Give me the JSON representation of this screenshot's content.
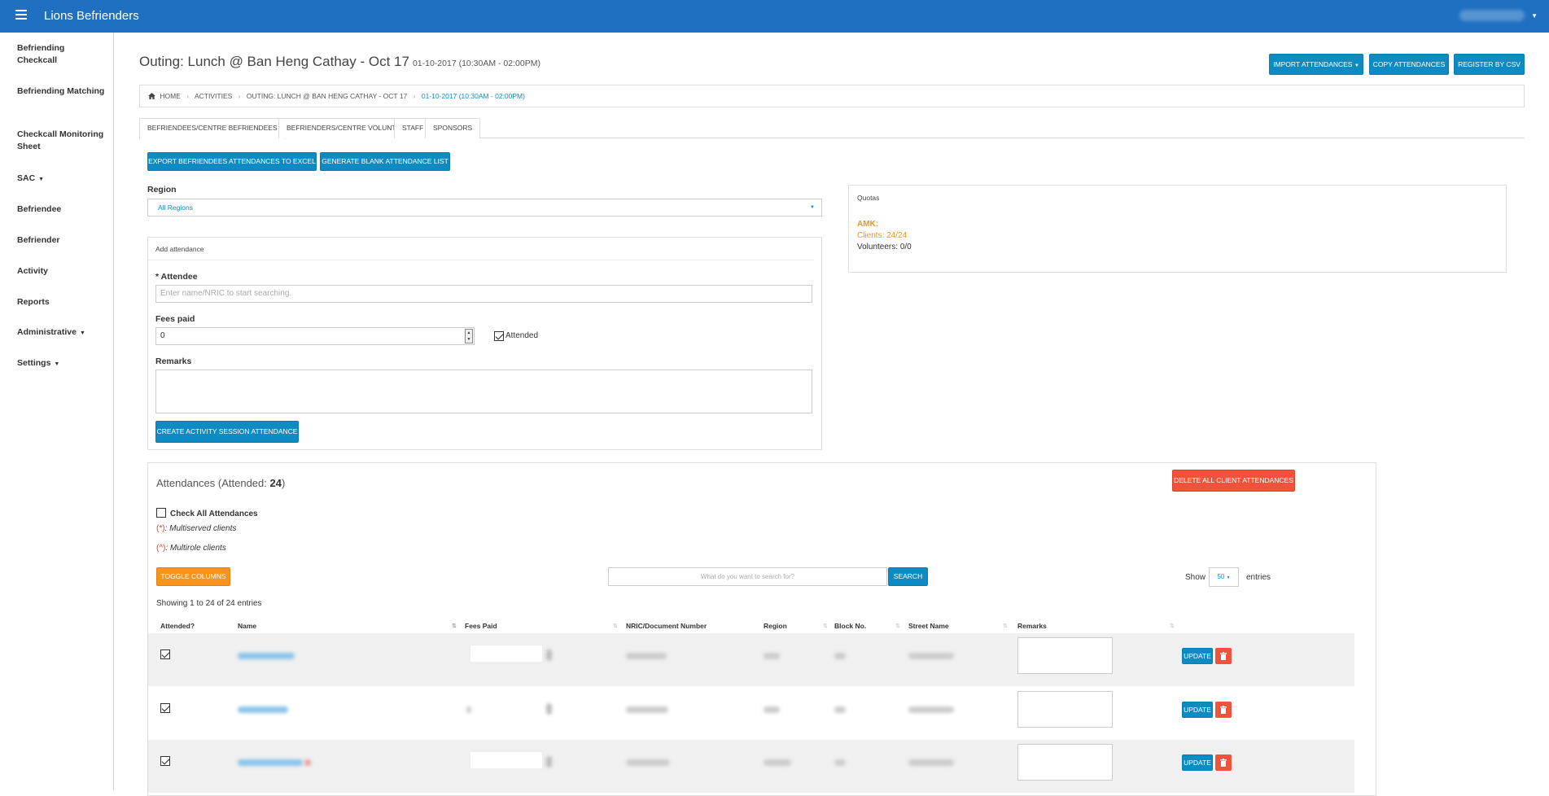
{
  "header": {
    "app_title": "Lions Befrienders"
  },
  "sidebar": {
    "items": [
      {
        "label": "Befriending Checkcall"
      },
      {
        "label": "Befriending Matching"
      },
      {
        "label": "Checkcall Monitoring Sheet"
      },
      {
        "label": "SAC"
      },
      {
        "label": "Befriendee"
      },
      {
        "label": "Befriender"
      },
      {
        "label": "Activity"
      },
      {
        "label": "Reports"
      },
      {
        "label": "Administrative"
      },
      {
        "label": "Settings"
      }
    ]
  },
  "page": {
    "title": "Outing: Lunch @ Ban Heng Cathay - Oct 17",
    "subtitle": "01-10-2017 (10:30AM - 02:00PM)",
    "buttons": {
      "import": "Import Attendances",
      "copy": "Copy Attendances",
      "register": "Register by CSV"
    }
  },
  "breadcrumb": {
    "home": "Home",
    "activities": "Activities",
    "activity": "Outing: Lunch @ Ban Heng Cathay - Oct 17",
    "session": "01-10-2017 (10:30AM - 02:00PM)"
  },
  "tabs": [
    {
      "label": "Befriendees/Centre Befriendees"
    },
    {
      "label": "Befrienders/Centre Volunteers"
    },
    {
      "label": "Staff"
    },
    {
      "label": "Sponsors"
    }
  ],
  "actions": {
    "export": "Export Befriendees Attendances to Excel",
    "generate": "Generate Blank Attendance List"
  },
  "region": {
    "label": "Region",
    "selected": "All Regions"
  },
  "add_attendance": {
    "title": "Add attendance",
    "attendee_label": "* Attendee",
    "attendee_placeholder": "Enter name/NRIC to start searching.",
    "fees_label": "Fees paid",
    "fees_value": "0",
    "attended_label": "Attended",
    "remarks_label": "Remarks",
    "create_button": "Create Activity Session Attendance"
  },
  "quotas": {
    "title": "Quotas",
    "region": "AMK:",
    "clients": "Clients: 24/24",
    "volunteers": "Volunteers: 0/0"
  },
  "attendances": {
    "title_prefix": "Attendances (Attended: ",
    "attended_count": "24",
    "title_suffix": ")",
    "delete_all": "Delete All Client Attendances",
    "check_all": "Check All Attendances",
    "legend_multiserved_mark": "(*)",
    "legend_multiserved": ": Multiserved clients",
    "legend_multirole_mark": "(^)",
    "legend_multirole": ": Multirole clients",
    "toggle_columns": "Toggle Columns",
    "search_placeholder": "What do you want to search for?",
    "search_button": "Search",
    "show_label": "Show",
    "page_size": "50",
    "entries_label": "entries",
    "showing": "Showing 1 to 24 of 24 entries",
    "columns": [
      "Attended?",
      "Name",
      "Fees Paid",
      "NRIC/Document Number",
      "Region",
      "Block No.",
      "Street Name",
      "Remarks"
    ],
    "update_label": "Update"
  },
  "colors": {
    "primary": "#1f70c1",
    "button": "#0f8bc4",
    "danger": "#f0533c",
    "warning": "#f7931e"
  }
}
